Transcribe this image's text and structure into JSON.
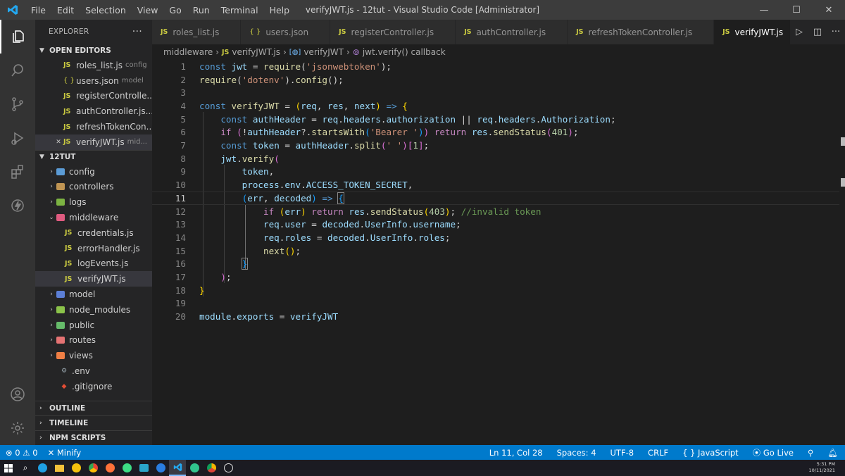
{
  "window": {
    "title": "verifyJWT.js - 12tut - Visual Studio Code [Administrator]",
    "menu": [
      "File",
      "Edit",
      "Selection",
      "View",
      "Go",
      "Run",
      "Terminal",
      "Help"
    ],
    "controls": {
      "minimize": "—",
      "maximize": "☐",
      "close": "✕"
    }
  },
  "sidebar": {
    "header": "EXPLORER",
    "more": "···",
    "open_editors_label": "OPEN EDITORS",
    "open_editors": [
      {
        "name": "roles_list.js",
        "hint": "config",
        "type": "js"
      },
      {
        "name": "users.json",
        "hint": "model",
        "type": "json"
      },
      {
        "name": "registerControlle...",
        "hint": "",
        "type": "js"
      },
      {
        "name": "authController.js...",
        "hint": "",
        "type": "js"
      },
      {
        "name": "refreshTokenCon...",
        "hint": "",
        "type": "js"
      },
      {
        "name": "verifyJWT.js",
        "hint": "mid...",
        "type": "js"
      }
    ],
    "project_label": "12TUT",
    "tree": [
      {
        "name": "config",
        "kind": "folder",
        "color": "#5b9bd5"
      },
      {
        "name": "controllers",
        "kind": "folder",
        "color": "#c09553"
      },
      {
        "name": "logs",
        "kind": "folder",
        "color": "#7cb342"
      },
      {
        "name": "middleware",
        "kind": "folder-open",
        "color": "#e05b80"
      },
      {
        "name": "credentials.js",
        "kind": "js"
      },
      {
        "name": "errorHandler.js",
        "kind": "js"
      },
      {
        "name": "logEvents.js",
        "kind": "js"
      },
      {
        "name": "verifyJWT.js",
        "kind": "js"
      },
      {
        "name": "model",
        "kind": "folder",
        "color": "#5c7fd6"
      },
      {
        "name": "node_modules",
        "kind": "folder",
        "color": "#8bc34a"
      },
      {
        "name": "public",
        "kind": "folder",
        "color": "#66bb6a"
      },
      {
        "name": "routes",
        "kind": "folder",
        "color": "#e57373"
      },
      {
        "name": "views",
        "kind": "folder",
        "color": "#ef7f45"
      },
      {
        "name": ".env",
        "kind": "gear"
      },
      {
        "name": ".gitignore",
        "kind": "git"
      }
    ],
    "outline_label": "OUTLINE",
    "timeline_label": "TIMELINE",
    "npm_label": "NPM SCRIPTS"
  },
  "tabs": [
    {
      "name": "roles_list.js",
      "type": "js"
    },
    {
      "name": "users.json",
      "type": "json"
    },
    {
      "name": "registerController.js",
      "type": "js"
    },
    {
      "name": "authController.js",
      "type": "js"
    },
    {
      "name": "refreshTokenController.js",
      "type": "js"
    },
    {
      "name": "verifyJWT.js",
      "type": "js",
      "active": true
    }
  ],
  "breadcrumb": [
    "middleware",
    "verifyJWT.js",
    "verifyJWT",
    "jwt.verify() callback"
  ],
  "editor": {
    "cursor_line": 11,
    "line_numbers": [
      "1",
      "2",
      "3",
      "4",
      "5",
      "6",
      "7",
      "8",
      "9",
      "10",
      "11",
      "12",
      "13",
      "14",
      "15",
      "16",
      "17",
      "18",
      "19",
      "20"
    ]
  },
  "status": {
    "problems": "0",
    "warnings": "0",
    "minify": "Minify",
    "position": "Ln 11, Col 28",
    "spaces": "Spaces: 4",
    "encoding": "UTF-8",
    "eol": "CRLF",
    "language": "JavaScript",
    "golive": "Go Live"
  },
  "taskbar": {
    "time": "5:31 PM",
    "date": "10/11/2021"
  },
  "colors": {
    "statusbar": "#007acc",
    "accent": "#0e639c"
  }
}
